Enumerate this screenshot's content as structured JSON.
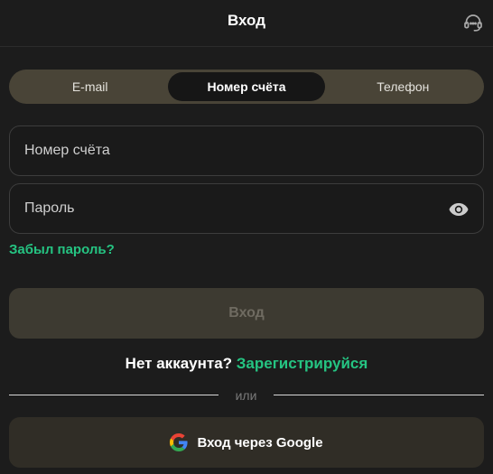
{
  "header": {
    "title": "Вход",
    "support_icon": "headset-icon"
  },
  "tabs": [
    {
      "label": "E-mail",
      "active": false
    },
    {
      "label": "Номер счёта",
      "active": true
    },
    {
      "label": "Телефон",
      "active": false
    }
  ],
  "form": {
    "account_placeholder": "Номер счёта",
    "account_value": "",
    "password_placeholder": "Пароль",
    "password_value": "",
    "password_toggle_icon": "eye-icon",
    "forgot_label": "Забыл пароль?",
    "submit_label": "Вход"
  },
  "register": {
    "question": "Нет аккаунта?",
    "link_label": "Зарегистрируйся"
  },
  "divider": {
    "label": "или"
  },
  "google": {
    "label": "Вход через Google",
    "icon": "google-icon"
  },
  "colors": {
    "background": "#1c1c1c",
    "accent_green": "#25c482",
    "tabs_background": "#494437",
    "active_tab": "#161616",
    "disabled_button": "#3d3a31",
    "google_button": "#302d26"
  }
}
